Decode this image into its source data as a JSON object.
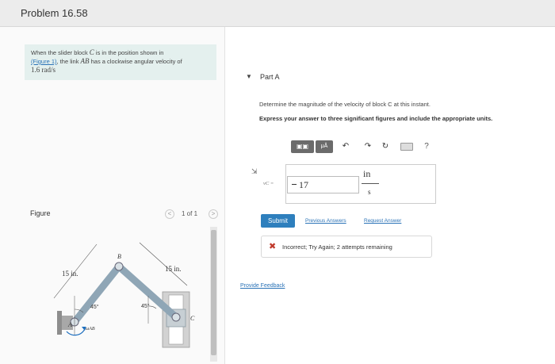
{
  "header": {
    "title": "Problem 16.58"
  },
  "problem": {
    "text_1": "When the slider block ",
    "block_symbol": "C",
    "text_2": " is in the position shown in",
    "figure_link": "(Figure 1)",
    "text_3": ", the link ",
    "link_symbol": "AB",
    "text_4": " has a clockwise angular velocity of",
    "omega_value": "1.6 rad/s"
  },
  "figure": {
    "label": "Figure",
    "pager_prev": "<",
    "pager_count": "1 of 1",
    "pager_next": ">",
    "dim_left": "15 in.",
    "dim_right": "15 in.",
    "point_a": "A",
    "point_b": "B",
    "point_c": "C",
    "angle_left": "45°",
    "angle_right": "45°",
    "omega_label": "ωAB"
  },
  "part": {
    "toggle": "▼",
    "title": "Part A",
    "question": "Determine the magnitude of the velocity of block C at this instant.",
    "instruction": "Express your answer to three significant figures and include the appropriate units."
  },
  "toolbar": {
    "templates": "▣▣",
    "units": "μÅ",
    "undo": "↶",
    "redo": "↷",
    "reset": "↻",
    "help": "?"
  },
  "answer": {
    "label": "vC =",
    "value": "17",
    "unit_numerator": "in",
    "unit_denominator": "s"
  },
  "actions": {
    "submit": "Submit",
    "previous_answers": "Previous Answers",
    "request_answer": "Request Answer"
  },
  "feedback": {
    "icon": "✖",
    "message": "Incorrect; Try Again; 2 attempts remaining"
  },
  "footer": {
    "provide_feedback": "Provide Feedback"
  }
}
